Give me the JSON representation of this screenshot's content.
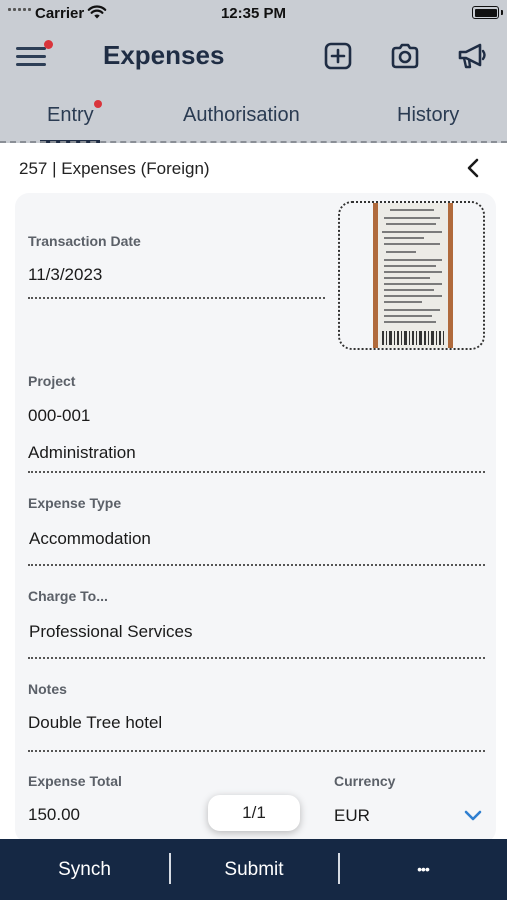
{
  "status_bar": {
    "carrier": "Carrier",
    "time": "12:35 PM",
    "battery_level": 1.0
  },
  "header": {
    "title": "Expenses",
    "menu_icon": "hamburger-menu-icon",
    "actions": [
      "add-square-icon",
      "camera-icon",
      "megaphone-icon"
    ]
  },
  "tabs": [
    {
      "label": "Entry",
      "active": true,
      "badge": true
    },
    {
      "label": "Authorisation",
      "active": false
    },
    {
      "label": "History",
      "active": false
    }
  ],
  "subheader": {
    "title": "257 | Expenses (Foreign)"
  },
  "form": {
    "transaction_date": {
      "label": "Transaction Date",
      "value": "11/3/2023"
    },
    "project": {
      "label": "Project",
      "code": "000-001",
      "name": "Administration"
    },
    "expense_type": {
      "label": "Expense Type",
      "value": "Accommodation"
    },
    "charge_to": {
      "label": "Charge To...",
      "value": "Professional Services"
    },
    "notes": {
      "label": "Notes",
      "value": "Double Tree hotel"
    },
    "expense_total": {
      "label": "Expense Total",
      "value": "150.00"
    },
    "currency": {
      "label": "Currency",
      "value": "EUR"
    }
  },
  "pager": {
    "text": "1/1"
  },
  "bottom_bar": {
    "synch": "Synch",
    "submit": "Submit",
    "more": "•••"
  },
  "colors": {
    "header_bg": "#c9cdd3",
    "navy": "#1f2d44",
    "bottom_bar_bg": "#152844",
    "badge_red": "#d9343b",
    "accent_blue": "#2f7fd0",
    "card_bg": "#f5f6f8"
  }
}
